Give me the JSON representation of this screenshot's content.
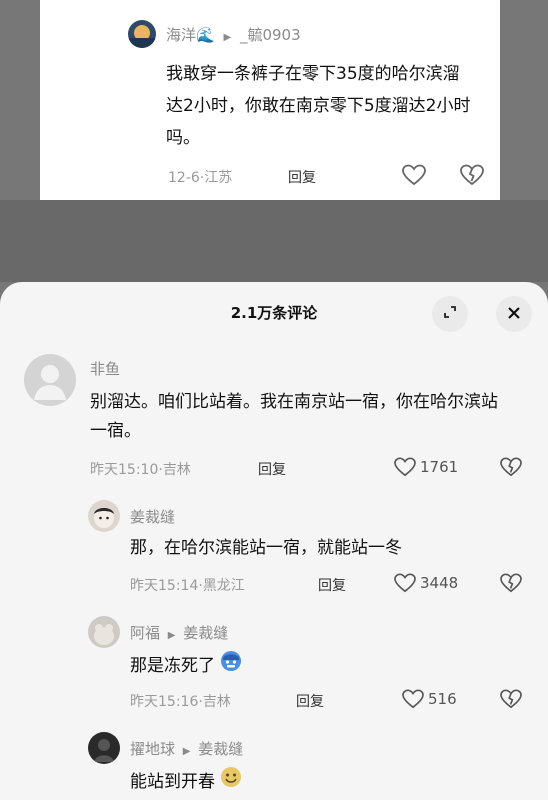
{
  "top_comment": {
    "author": "海洋🌊",
    "reply_arrow": "▶",
    "reply_to": "_毓0903",
    "text": "我敢穿一条裤子在零下35度的哈尔滨溜达2小时，你敢在南京零下5度溜达2小时吗。",
    "date": "12-6",
    "location": "江苏",
    "reply_label": "回复"
  },
  "sheet": {
    "title": "2.1万条评论"
  },
  "comments": [
    {
      "author": "非鱼",
      "text": "别溜达。咱们比站着。我在南京站一宿，你在哈尔滨站一宿。",
      "time": "昨天15:10",
      "location": "吉林",
      "reply_label": "回复",
      "likes": "1761"
    }
  ],
  "replies": [
    {
      "author": "姜裁缝",
      "text": "那，在哈尔滨能站一宿，就能站一冬",
      "time": "昨天15:14",
      "location": "黑龙江",
      "reply_label": "回复",
      "likes": "3448"
    },
    {
      "author": "阿福",
      "reply_arrow": "▶",
      "reply_to": "姜裁缝",
      "text": "那是冻死了",
      "time": "昨天15:16",
      "location": "吉林",
      "reply_label": "回复",
      "likes": "516"
    },
    {
      "author": "擢地球",
      "reply_arrow": "▶",
      "reply_to": "姜裁缝",
      "text": "能站到开春"
    }
  ],
  "separator": "·"
}
